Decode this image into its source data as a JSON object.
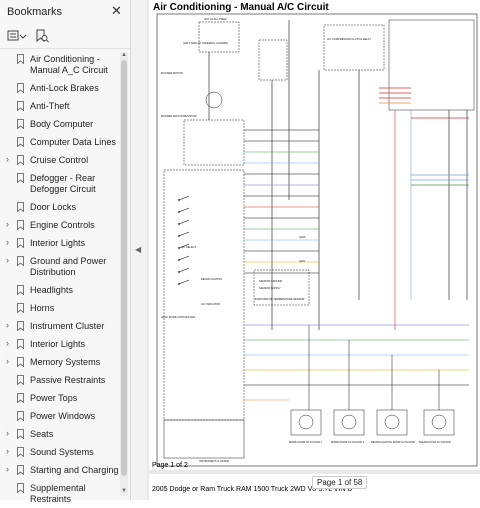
{
  "sidebar": {
    "title": "Bookmarks",
    "items": [
      {
        "label": "Air Conditioning - Manual A_C Circuit",
        "expandable": false
      },
      {
        "label": "Anti-Lock Brakes",
        "expandable": false
      },
      {
        "label": "Anti-Theft",
        "expandable": false
      },
      {
        "label": "Body Computer",
        "expandable": false
      },
      {
        "label": "Computer Data Lines",
        "expandable": false
      },
      {
        "label": "Cruise Control",
        "expandable": true
      },
      {
        "label": "Defogger - Rear Defogger Circuit",
        "expandable": false
      },
      {
        "label": "Door Locks",
        "expandable": false
      },
      {
        "label": "Engine Controls",
        "expandable": true
      },
      {
        "label": "Interior Lights",
        "expandable": true
      },
      {
        "label": "Ground and Power Distribution",
        "expandable": true
      },
      {
        "label": "Headlights",
        "expandable": false
      },
      {
        "label": "Horns",
        "expandable": false
      },
      {
        "label": "Instrument Cluster",
        "expandable": true
      },
      {
        "label": "Interior Lights",
        "expandable": true
      },
      {
        "label": "Memory Systems",
        "expandable": true
      },
      {
        "label": "Passive Restraints",
        "expandable": false
      },
      {
        "label": "Power Tops",
        "expandable": false
      },
      {
        "label": "Power Windows",
        "expandable": false
      },
      {
        "label": "Seats",
        "expandable": true
      },
      {
        "label": "Sound Systems",
        "expandable": true
      },
      {
        "label": "Starting and Charging",
        "expandable": true
      },
      {
        "label": "Supplemental Restraints",
        "expandable": false
      }
    ]
  },
  "document": {
    "page_title": "Air Conditioning - Manual A/C Circuit",
    "footer_page": "Page 1 of 2",
    "page_indicator": "Page 1 of 58",
    "next_page_text": "2005 Dodge or Ram Truck RAM 1500 Truck 2WD V8-5.7L VIN D"
  },
  "diagram_labels": {
    "hot_all_times": "HOT AT ALL TIMES",
    "ignition_switch": "(LEFT SIDE OF STEERING COLUMN)",
    "blower_motor": "BLOWER MOTOR",
    "blower_resistor": "BLOWER MOTOR RESISTOR",
    "ac_compressor_relay": "A/C COMPRESSOR CLUTCH RELAY",
    "hvac_control": "HVAC MODE CONTROLLER",
    "ac_select": "A/C SELECT",
    "recirc": "RECIRCULATION",
    "ac_indicator": "A/C INDICATOR",
    "sensor_ground": "SENSOR GROUND",
    "sensor_supply": "SENSOR SUPPLY",
    "evap_temp": "EVAPORATOR TEMPERATURE SENSOR",
    "mode_door_1": "MODE DOOR ACTUATOR 1",
    "mode_door_2": "MODE DOOR ACTUATOR 2",
    "recirc_door": "RECIRCULATION DOOR ACTUATOR",
    "blend_door": "BLEND DOOR ACTUATOR",
    "instrument_cluster": "INSTRUMENT CLUSTER",
    "g200": "G200",
    "g201": "G201"
  },
  "colors": {
    "wire_dark": "#111111",
    "wire_lt_blue": "#6aa9d9",
    "wire_green": "#3f9a4b",
    "wire_red": "#d22d2d",
    "wire_orange": "#e38b2c",
    "wire_violet": "#8a5bb8",
    "wire_yellow": "#c8b400",
    "accent": "#0b63c5"
  }
}
